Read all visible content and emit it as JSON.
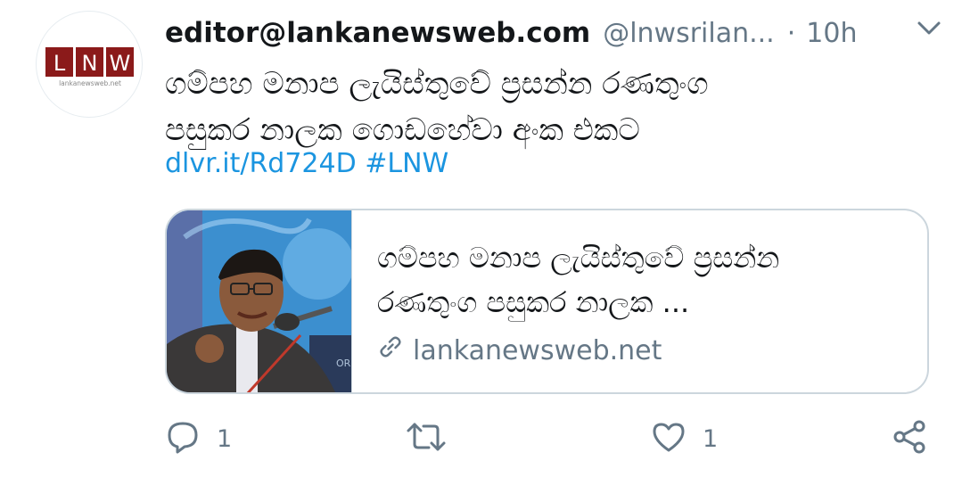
{
  "tweet": {
    "display_name": "editor@lankanewsweb.com",
    "handle": "@lnwsrilan...",
    "separator": "·",
    "timestamp": "10h",
    "text_line1": "ගම්පහ මනාප ලැයිස්තුවේ ප්‍රසන්න රණතුංග",
    "text_line2": "පසුකර නාලක ගොඩහේවා අංක එකට",
    "link": "dlvr.it/Rd724D",
    "hashtag": "#LNW"
  },
  "avatar": {
    "logo_text": "LNW",
    "logo_subtext": "lankanewsweb.net",
    "brand_color": "#8b1a1a"
  },
  "card": {
    "title_line1": "ගම්පහ මනාප ලැයිස්තුවේ ප්‍රසන්න",
    "title_line2": "රණතුංග පසුකර නාලක ...",
    "domain": "lankanewsweb.net"
  },
  "actions": {
    "reply_count": "1",
    "retweet_count": "",
    "like_count": "1"
  },
  "colors": {
    "link": "#1b95e0",
    "secondary_text": "#657786",
    "primary_text": "#14171a",
    "border": "#ccd6dd"
  },
  "icons": [
    "caret-down-icon",
    "link-icon",
    "reply-icon",
    "retweet-icon",
    "like-icon",
    "share-icon"
  ]
}
